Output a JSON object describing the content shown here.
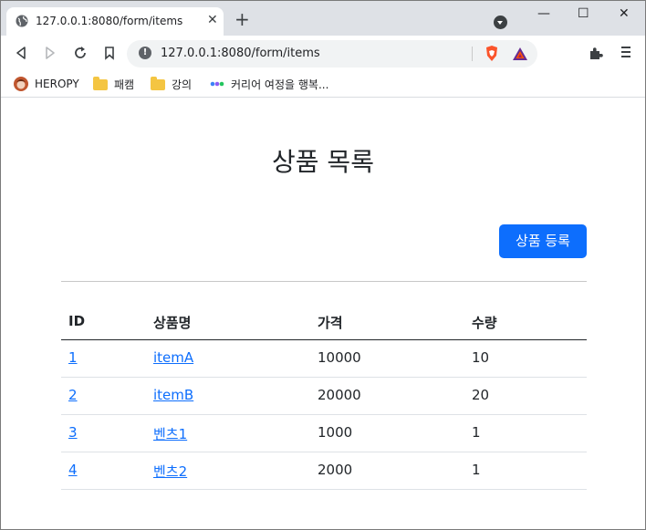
{
  "tab": {
    "title": "127.0.0.1:8080/form/items",
    "close": "✕",
    "new_tab": "+"
  },
  "window_controls": {
    "minimize": "—",
    "maximize": "☐",
    "close": "✕"
  },
  "address_bar": {
    "url": "127.0.0.1:8080/form/items",
    "info_glyph": "!"
  },
  "bookmarks": [
    {
      "label": "HEROPY",
      "icon": "avatar-icon"
    },
    {
      "label": "패캠",
      "icon": "folder-icon"
    },
    {
      "label": "강의",
      "icon": "folder-icon"
    },
    {
      "label": "커리어 여정을 행복...",
      "icon": "dots-icon"
    }
  ],
  "page": {
    "title": "상품 목록",
    "add_button": "상품 등록",
    "table": {
      "headers": [
        "ID",
        "상품명",
        "가격",
        "수량"
      ],
      "rows": [
        {
          "id": "1",
          "name": "itemA",
          "price": "10000",
          "quantity": "10"
        },
        {
          "id": "2",
          "name": "itemB",
          "price": "20000",
          "quantity": "20"
        },
        {
          "id": "3",
          "name": "벤츠1",
          "price": "1000",
          "quantity": "1"
        },
        {
          "id": "4",
          "name": "벤츠2",
          "price": "2000",
          "quantity": "1"
        }
      ]
    }
  },
  "colors": {
    "primary": "#0d6efd",
    "tabstrip": "#dee1e6",
    "text": "#212529"
  }
}
